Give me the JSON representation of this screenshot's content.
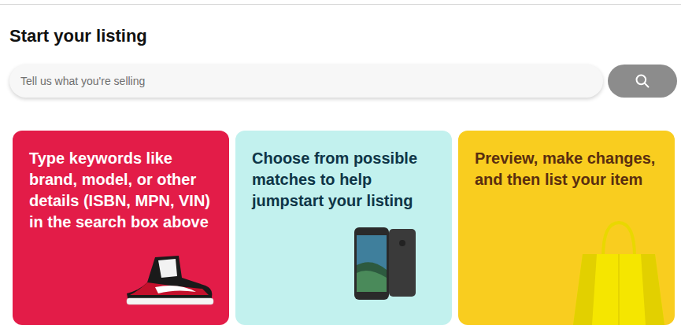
{
  "page": {
    "title": "Start your listing"
  },
  "search": {
    "placeholder": "Tell us what you're selling"
  },
  "cards": [
    {
      "text": "Type keywords like brand, model, or other details (ISBN, MPN, VIN) in the search box above",
      "color": "#e31c48",
      "kind": "sneaker"
    },
    {
      "text": "Choose from possible matches to help jumpstart your listing",
      "color": "#c2f1ee",
      "kind": "phone"
    },
    {
      "text": "Preview, make changes, and then list your item",
      "color": "#f9cd1f",
      "kind": "bag"
    }
  ]
}
